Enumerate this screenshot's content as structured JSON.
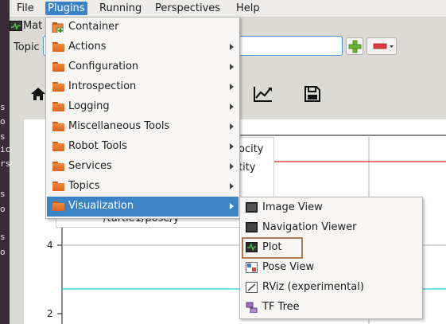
{
  "menubar": {
    "items": [
      "File",
      "Plugins",
      "Running",
      "Perspectives",
      "Help"
    ]
  },
  "terminal": {
    "glyphs": [
      "s",
      "o",
      "s",
      "ic",
      "rs",
      "s",
      "o",
      "s",
      "o"
    ]
  },
  "app": {
    "title_fragment": "Mat",
    "topic_label": "Topic",
    "topic_value": ""
  },
  "plot": {
    "legend_items": [
      "ocity",
      "tity",
      "/turtle1/pose/y"
    ],
    "y_ticks": [
      "4",
      "2"
    ],
    "lines": {
      "red": "#e0201c",
      "cyan": "#22d3e0"
    }
  },
  "plugins_menu": {
    "items": [
      {
        "label": "Container",
        "icon": "container-icon",
        "submenu": false
      },
      {
        "label": "Actions",
        "icon": "folder-icon",
        "submenu": true
      },
      {
        "label": "Configuration",
        "icon": "folder-icon",
        "submenu": true
      },
      {
        "label": "Introspection",
        "icon": "folder-icon",
        "submenu": true
      },
      {
        "label": "Logging",
        "icon": "folder-icon",
        "submenu": true
      },
      {
        "label": "Miscellaneous Tools",
        "icon": "folder-icon",
        "submenu": true
      },
      {
        "label": "Robot Tools",
        "icon": "folder-icon",
        "submenu": true
      },
      {
        "label": "Services",
        "icon": "folder-icon",
        "submenu": true
      },
      {
        "label": "Topics",
        "icon": "folder-icon",
        "submenu": true
      },
      {
        "label": "Visualization",
        "icon": "folder-icon",
        "submenu": true,
        "highlighted": true
      }
    ]
  },
  "visualization_menu": {
    "items": [
      {
        "label": "Image View",
        "icon": "image-view-icon"
      },
      {
        "label": "Navigation Viewer",
        "icon": "navigation-viewer-icon"
      },
      {
        "label": "Plot",
        "icon": "plot-icon",
        "outlined": true
      },
      {
        "label": "Pose View",
        "icon": "pose-view-icon"
      },
      {
        "label": "RViz (experimental)",
        "icon": "rviz-icon"
      },
      {
        "label": "TF Tree",
        "icon": "tf-tree-icon"
      }
    ]
  },
  "colors": {
    "highlight": "#3b83c4",
    "outline": "#b07a52",
    "folder": "#e8762c"
  }
}
